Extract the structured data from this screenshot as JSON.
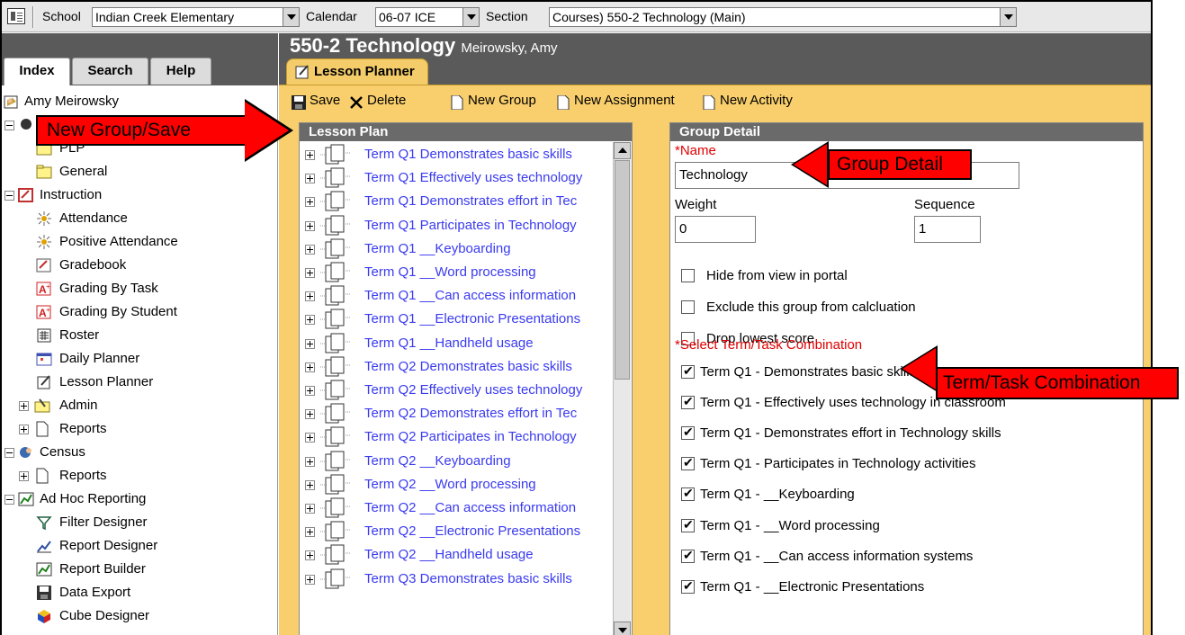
{
  "topbar": {
    "school_label": "School",
    "school_value": "Indian Creek Elementary",
    "calendar_label": "Calendar",
    "calendar_value": "06-07 ICE",
    "section_label": "Section",
    "section_value": "Courses) 550-2 Technology (Main)"
  },
  "left_tabs": [
    "Index",
    "Search",
    "Help"
  ],
  "tree": {
    "user": "Amy Meirowsky",
    "items": [
      {
        "label": "PLP",
        "level": 2
      },
      {
        "label": "General",
        "level": 2
      },
      {
        "label": "Instruction",
        "level": 1
      },
      {
        "label": "Attendance",
        "level": 2
      },
      {
        "label": "Positive Attendance",
        "level": 2
      },
      {
        "label": "Gradebook",
        "level": 2
      },
      {
        "label": "Grading By Task",
        "level": 2
      },
      {
        "label": "Grading By Student",
        "level": 2
      },
      {
        "label": "Roster",
        "level": 2
      },
      {
        "label": "Daily Planner",
        "level": 2
      },
      {
        "label": "Lesson Planner",
        "level": 2
      },
      {
        "label": "Admin",
        "level": 2
      },
      {
        "label": "Reports",
        "level": 2
      },
      {
        "label": "Census",
        "level": 1
      },
      {
        "label": "Reports",
        "level": 2
      },
      {
        "label": "Ad Hoc Reporting",
        "level": 1
      },
      {
        "label": "Filter Designer",
        "level": 2
      },
      {
        "label": "Report Designer",
        "level": 2
      },
      {
        "label": "Report Builder",
        "level": 2
      },
      {
        "label": "Data Export",
        "level": 2
      },
      {
        "label": "Cube Designer",
        "level": 2
      }
    ]
  },
  "content": {
    "title": "550-2 Technology",
    "teacher": "Meirowsky, Amy",
    "tab": "Lesson Planner"
  },
  "toolbar": {
    "save": "Save",
    "delete": "Delete",
    "new_group": "New Group",
    "new_assignment": "New Assignment",
    "new_activity": "New Activity"
  },
  "lesson_plan": {
    "header": "Lesson Plan",
    "rows": [
      "Term Q1 Demonstrates basic skills",
      "Term Q1 Effectively uses technology",
      "Term Q1 Demonstrates effort in Tec",
      "Term Q1 Participates in Technology",
      "Term Q1 __Keyboarding",
      "Term Q1 __Word processing",
      "Term Q1 __Can access information",
      "Term Q1 __Electronic Presentations",
      "Term Q1 __Handheld usage",
      "Term Q2 Demonstrates basic skills",
      "Term Q2 Effectively uses technology",
      "Term Q2 Demonstrates effort in Tec",
      "Term Q2 Participates in Technology",
      "Term Q2 __Keyboarding",
      "Term Q2 __Word processing",
      "Term Q2 __Can access information",
      "Term Q2 __Electronic Presentations",
      "Term Q2 __Handheld usage",
      "Term Q3 Demonstrates basic skills"
    ]
  },
  "group_detail": {
    "header": "Group Detail",
    "name_label": "*Name",
    "name_value": "Technology",
    "weight_label": "Weight",
    "weight_value": "0",
    "sequence_label": "Sequence",
    "sequence_value": "1",
    "options": [
      {
        "label": "Hide from view in portal",
        "checked": false
      },
      {
        "label": "Exclude this group from calcluation",
        "checked": false
      },
      {
        "label": "Drop lowest score",
        "checked": false
      }
    ],
    "combo_label": "*Select Term/Task Combination",
    "combos": [
      {
        "label": "Term Q1 - Demonstrates basic skills",
        "checked": true
      },
      {
        "label": "Term Q1 - Effectively uses technology in classroom",
        "checked": true
      },
      {
        "label": "Term Q1 - Demonstrates effort in Technology skills",
        "checked": true
      },
      {
        "label": "Term Q1 - Participates in Technology activities",
        "checked": true
      },
      {
        "label": "Term Q1 - __Keyboarding",
        "checked": true
      },
      {
        "label": "Term Q1 - __Word processing",
        "checked": true
      },
      {
        "label": "Term Q1 - __Can access information systems",
        "checked": true
      },
      {
        "label": "Term Q1 - __Electronic Presentations",
        "checked": true
      }
    ]
  },
  "callouts": {
    "new_group_save": "New Group/Save",
    "group_detail": "Group Detail",
    "term_task": "Term/Task Combination"
  },
  "colors": {
    "accent_orange": "#f9cf6d",
    "header_gray": "#5a5a5a",
    "link_blue": "#3a3af0",
    "required_red": "#e00000",
    "callout_red": "#ff0000"
  }
}
